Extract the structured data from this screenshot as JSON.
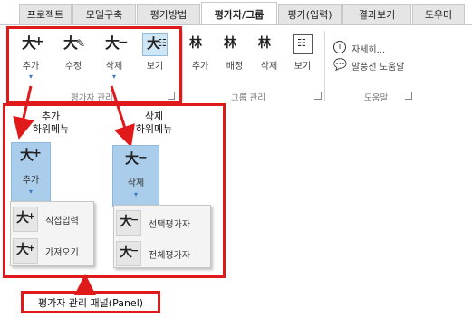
{
  "tabs": [
    "프로젝트",
    "모델구축",
    "평가방법",
    "평가자/그룹",
    "평가(입력)",
    "결과보기",
    "도우미"
  ],
  "ribbon": {
    "evaluator_group": {
      "add": "추가",
      "edit": "수정",
      "delete": "삭제",
      "view": "보기",
      "label": "평가자 관리"
    },
    "group_group": {
      "add": "추가",
      "assign": "배정",
      "delete": "삭제",
      "view": "보기",
      "label": "그룹 관리"
    },
    "help_group": {
      "details": "자세히...",
      "balloon_help": "말풍선 도움말",
      "label": "도움말"
    }
  },
  "annotations": {
    "add_submenu_line1": "추가",
    "add_submenu_line2": "하위메뉴",
    "delete_submenu_line1": "삭제",
    "delete_submenu_line2": "하위메뉴",
    "panel_caption": "평가자 관리 패널(Panel)"
  },
  "add_menu": {
    "button": "추가",
    "items": [
      "직접입력",
      "가져오기"
    ]
  },
  "delete_menu": {
    "button": "삭제",
    "items": [
      "선택평가자",
      "전체평가자"
    ]
  },
  "colors": {
    "highlight_red": "#e0191b",
    "selected_blue": "#a9cdea"
  }
}
